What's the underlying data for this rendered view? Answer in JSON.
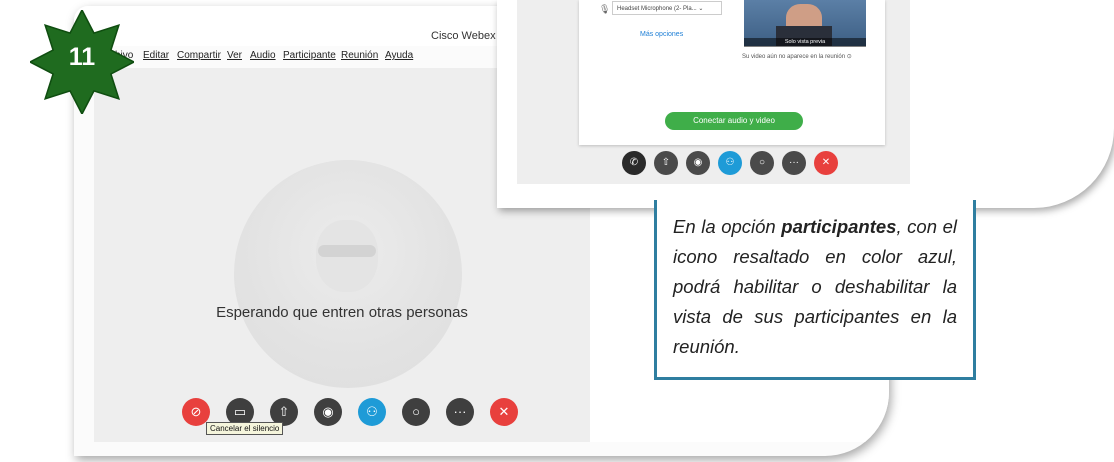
{
  "badge": {
    "number": "11",
    "color": "#1f6b1f"
  },
  "window": {
    "title": "Cisco Webex M"
  },
  "menu": [
    "chivo",
    "Editar",
    "Compartir",
    "Ver",
    "Audio",
    "Participante",
    "Reunión",
    "Ayuda"
  ],
  "stage": {
    "waiting_text": "Esperando que entren otras personas",
    "tooltip": "Cancelar el silencio",
    "controls": [
      {
        "name": "mute",
        "icon": "microphone-muted-icon",
        "glyph": "⊘",
        "color": "#e8403d"
      },
      {
        "name": "video",
        "icon": "video-camera-icon",
        "glyph": "▭",
        "color": "#3f3f3f"
      },
      {
        "name": "share",
        "icon": "share-upload-icon",
        "glyph": "⇧",
        "color": "#3f3f3f"
      },
      {
        "name": "record",
        "icon": "record-icon",
        "glyph": "◉",
        "color": "#3f3f3f"
      },
      {
        "name": "participants",
        "icon": "participants-icon",
        "glyph": "⚇",
        "color": "#1e9bd7"
      },
      {
        "name": "chat",
        "icon": "chat-bubble-icon",
        "glyph": "○",
        "color": "#3f3f3f"
      },
      {
        "name": "more",
        "icon": "more-options-icon",
        "glyph": "···",
        "color": "#3f3f3f"
      },
      {
        "name": "leave",
        "icon": "leave-x-icon",
        "glyph": "✕",
        "color": "#e8403d"
      }
    ]
  },
  "inset": {
    "mic_select": "Headset Microphone (2- Pla...",
    "more_options": "Más opciones",
    "preview_label": "Solo vista previa",
    "preview_note": "Su video aún no aparece en la reunión",
    "connect_button": "Conectar audio y video",
    "controls": [
      {
        "name": "audio",
        "icon": "phone-audio-icon",
        "glyph": "✆",
        "color": "#2a2a2a"
      },
      {
        "name": "share",
        "icon": "share-upload-icon",
        "glyph": "⇧",
        "color": "#4a4a4a"
      },
      {
        "name": "record",
        "icon": "record-icon",
        "glyph": "◉",
        "color": "#4a4a4a"
      },
      {
        "name": "participants",
        "icon": "participants-icon",
        "glyph": "⚇",
        "color": "#1e9bd7"
      },
      {
        "name": "chat",
        "icon": "chat-bubble-icon",
        "glyph": "○",
        "color": "#4a4a4a"
      },
      {
        "name": "more",
        "icon": "more-options-icon",
        "glyph": "···",
        "color": "#4a4a4a"
      },
      {
        "name": "leave",
        "icon": "leave-x-icon",
        "glyph": "✕",
        "color": "#e8403d"
      }
    ]
  },
  "caption": {
    "part1": "En la opción ",
    "bold": "participantes",
    "part2": ", con el icono resaltado en color azul, podrá habilitar o deshabilitar la vista de sus participantes en la reunión."
  }
}
